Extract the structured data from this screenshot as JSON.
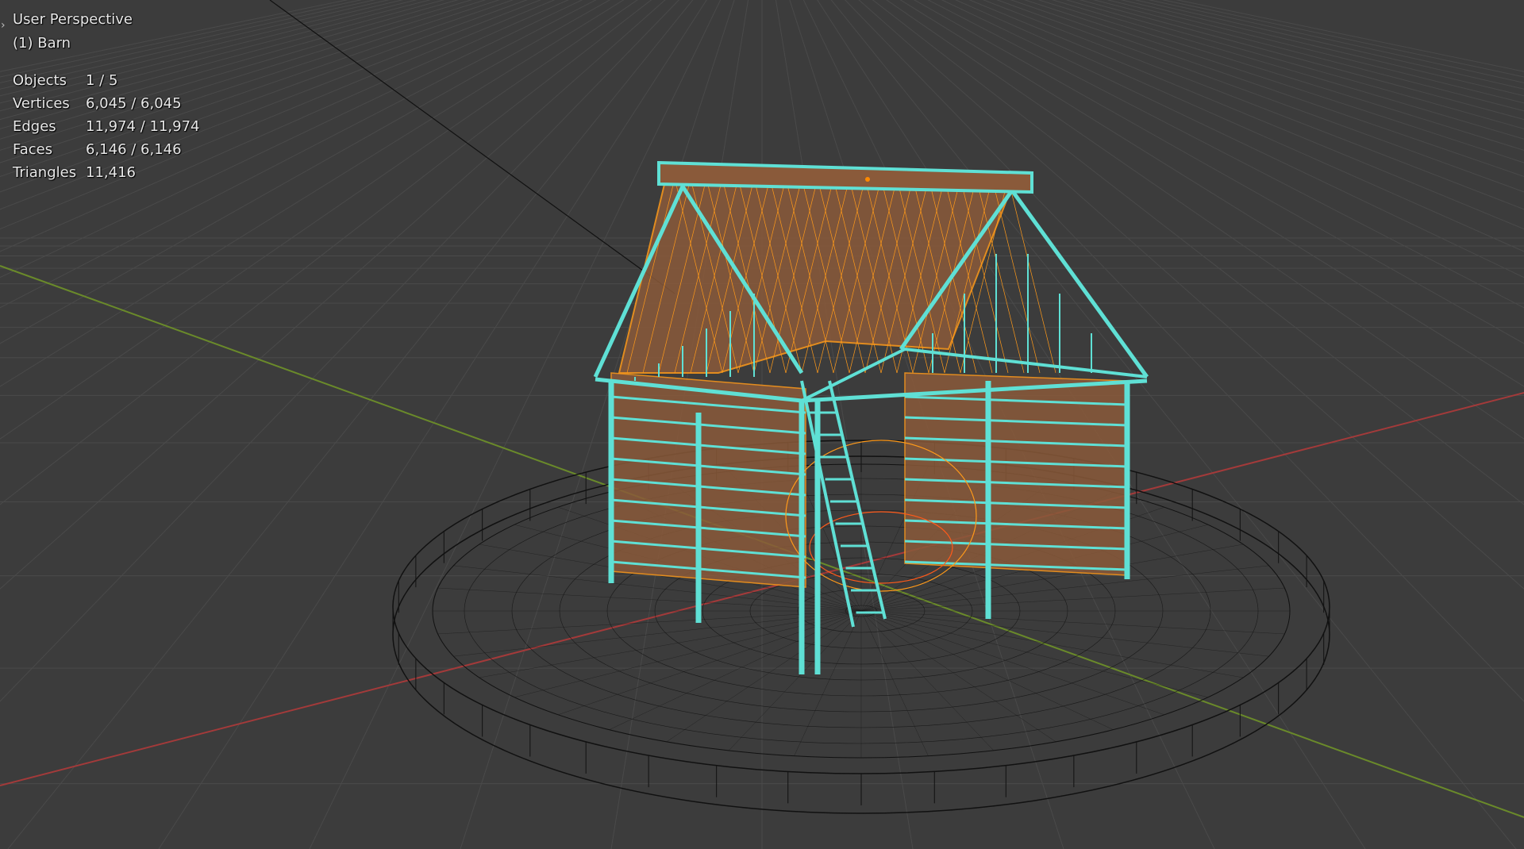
{
  "viewport": {
    "view_name": "User Perspective",
    "active_object": "(1) Barn",
    "stats": [
      {
        "label": "Objects",
        "value": "1 / 5"
      },
      {
        "label": "Vertices",
        "value": "6,045 / 6,045"
      },
      {
        "label": "Edges",
        "value": "11,974 / 11,974"
      },
      {
        "label": "Faces",
        "value": "6,146 / 6,146"
      },
      {
        "label": "Triangles",
        "value": "11,416"
      }
    ],
    "toggle_icon": "chevron-right-icon"
  },
  "colors": {
    "background": "#3c3c3c",
    "grid": "#4a4a4a",
    "x_axis": "#a33a3a",
    "y_axis": "#6a8a2a",
    "selected_wire": "#5fe0d5",
    "orange_wire": "#ff9a1a",
    "wall_fill": "#8a5a3a",
    "black_wire": "#111111"
  }
}
